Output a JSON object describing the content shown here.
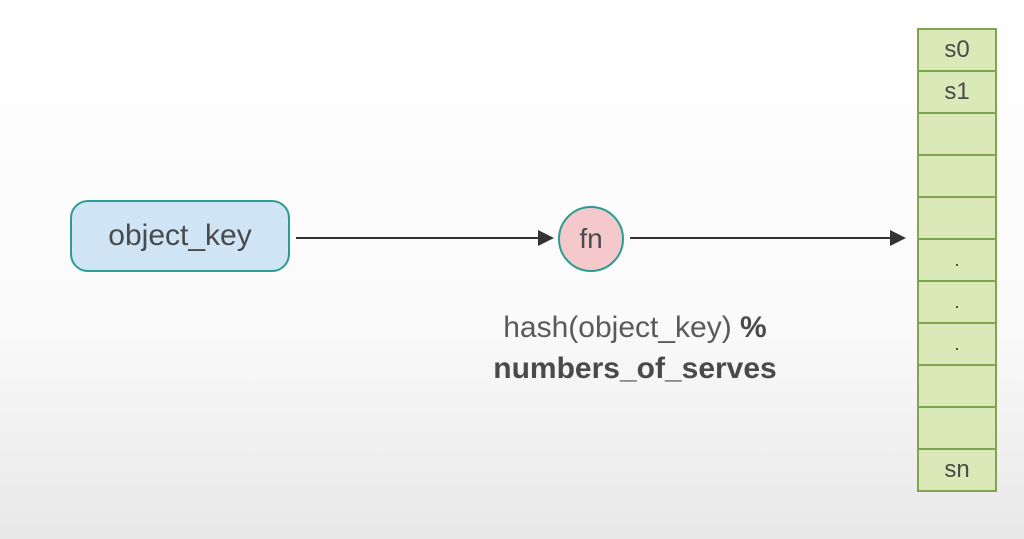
{
  "object_key": {
    "label": "object_key"
  },
  "fn_node": {
    "label": "fn"
  },
  "formula": {
    "part1": "hash(object_key) ",
    "part2_bold": "%",
    "part3_bold": "numbers_of_serves"
  },
  "servers": {
    "cells": [
      "s0",
      "s1",
      "",
      "",
      "",
      ".",
      ".",
      ".",
      "",
      "",
      "sn"
    ]
  },
  "colors": {
    "node_border": "#2a9d8f",
    "object_key_fill": "#cfe5f6",
    "fn_fill": "#f5c9cc",
    "server_fill": "#dbe8b8",
    "server_border": "#7fa64f",
    "arrow": "#333333",
    "text": "#4a4a4a"
  }
}
